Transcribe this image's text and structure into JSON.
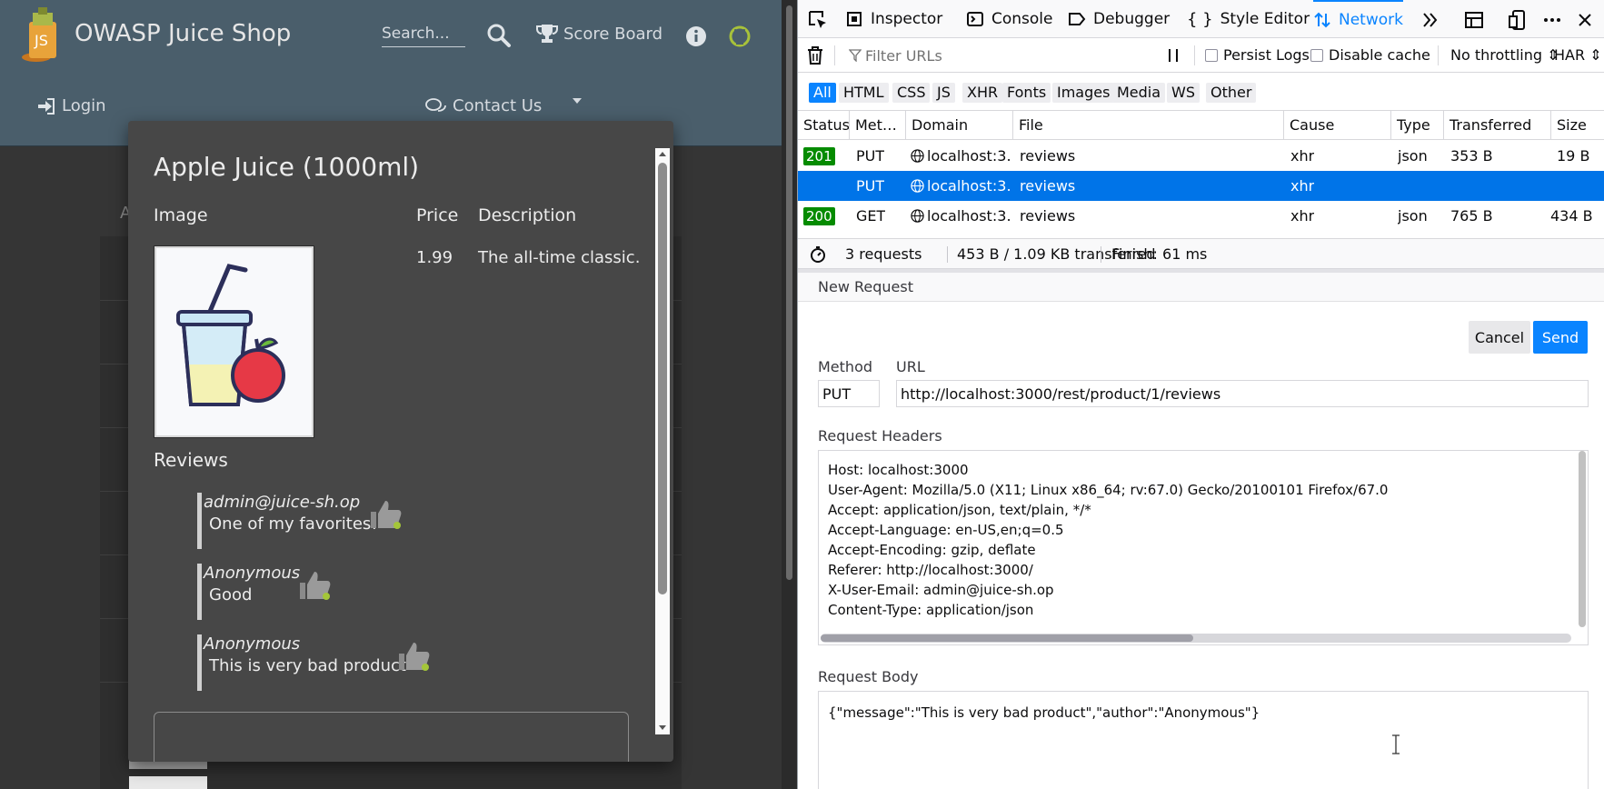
{
  "app": {
    "title": "OWASP Juice Shop",
    "search_placeholder": "Search...",
    "score_board": "Score Board",
    "login": "Login",
    "contact_us": "Contact Us",
    "background_letter": "A"
  },
  "product_modal": {
    "name": "Apple Juice (1000ml)",
    "headers": {
      "image": "Image",
      "price": "Price",
      "description": "Description"
    },
    "price": "1.99",
    "description": "The all-time classic.",
    "reviews_heading": "Reviews",
    "reviews": [
      {
        "author": "admin@juice-sh.op",
        "message": "One of my favorites!"
      },
      {
        "author": "Anonymous",
        "message": "Good"
      },
      {
        "author": "Anonymous",
        "message": "This is very bad product"
      }
    ]
  },
  "devtools": {
    "tabs": [
      {
        "label": "Inspector",
        "icon": "inspector-icon"
      },
      {
        "label": "Console",
        "icon": "console-icon"
      },
      {
        "label": "Debugger",
        "icon": "debugger-icon"
      },
      {
        "label": "Style Editor",
        "icon": "braces-icon"
      },
      {
        "label": "Network",
        "icon": "network-icon",
        "active": true
      }
    ],
    "filter_placeholder": "Filter URLs",
    "persist_logs": "Persist Logs",
    "disable_cache": "Disable cache",
    "throttling": "No throttling",
    "har": "HAR",
    "types": [
      "All",
      "HTML",
      "CSS",
      "JS",
      "XHR",
      "Fonts",
      "Images",
      "Media",
      "WS",
      "Other"
    ],
    "active_type": "All",
    "columns": [
      "Status",
      "Met…",
      "Domain",
      "File",
      "Cause",
      "Type",
      "Transferred",
      "Size"
    ],
    "requests": [
      {
        "status": "201",
        "method": "PUT",
        "domain": "localhost:3…",
        "file": "reviews",
        "cause": "xhr",
        "type": "json",
        "transferred": "353 B",
        "size": "19 B"
      },
      {
        "status": "",
        "method": "PUT",
        "domain": "localhost:3…",
        "file": "reviews",
        "cause": "xhr",
        "type": "",
        "transferred": "",
        "size": "",
        "selected": true
      },
      {
        "status": "200",
        "method": "GET",
        "domain": "localhost:3…",
        "file": "reviews",
        "cause": "xhr",
        "type": "json",
        "transferred": "765 B",
        "size": "434 B"
      }
    ],
    "summary": {
      "requests": "3 requests",
      "transferred": "453 B / 1.09 KB transferred",
      "finish": "Finish: 61 ms"
    },
    "new_request": {
      "title": "New Request",
      "cancel": "Cancel",
      "send": "Send",
      "method_label": "Method",
      "url_label": "URL",
      "method": "PUT",
      "url": "http://localhost:3000/rest/product/1/reviews",
      "headers_label": "Request Headers",
      "headers": [
        "Host: localhost:3000",
        "User-Agent: Mozilla/5.0 (X11; Linux x86_64; rv:67.0) Gecko/20100101 Firefox/67.0",
        "Accept: application/json, text/plain, */*",
        "Accept-Language: en-US,en;q=0.5",
        "Accept-Encoding: gzip, deflate",
        "Referer: http://localhost:3000/",
        "X-User-Email: admin@juice-sh.op",
        "Content-Type: application/json"
      ],
      "body_label": "Request Body",
      "body": "{\"message\":\"This is very bad product\",\"author\":\"Anonymous\"}"
    }
  },
  "colors": {
    "accent": "#0a84ff",
    "selected_row": "#0074e8",
    "status_ok": "#058b00",
    "navbar": "#4a5e6b",
    "modal_bg": "#474747"
  }
}
